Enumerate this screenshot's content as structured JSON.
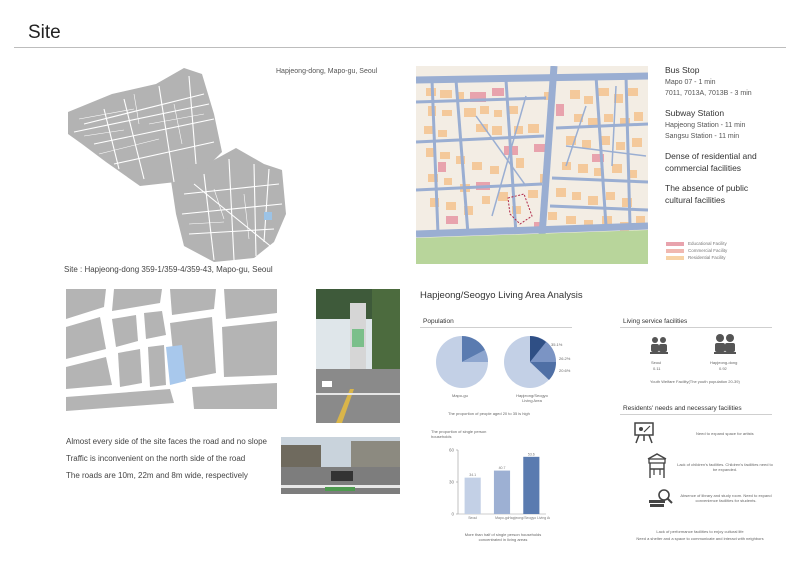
{
  "header": {
    "title": "Site"
  },
  "area_map": {
    "location_label": "Hapjeong-dong, Mapo-gu, Seoul",
    "site_caption": "Site : Hapjeong-dong 359-1/359-4/359-43, Mapo-gu, Seoul"
  },
  "transport": {
    "bus_heading": "Bus Stop",
    "bus_lines": [
      "Mapo 07 - 1 min",
      "7011, 7013A, 7013B - 3 min"
    ],
    "subway_heading": "Subway Station",
    "subway_lines": [
      "Hapjeong Station - 11 min",
      "Sangsu Station - 11 min"
    ],
    "note1": "Dense of residential and commercial facilities",
    "note2": "The absence of public cultural facilities"
  },
  "land_use_legend": [
    {
      "label": "Educational Facility",
      "color": "#e8a3ad"
    },
    {
      "label": "Commercial Facility",
      "color": "#f0b8b0"
    },
    {
      "label": "Residential Facility",
      "color": "#f7d3a6"
    }
  ],
  "road_notes": [
    "Almost every side of the site faces the road and no slope",
    "Traffic is inconvenient on the north side of the road",
    "The roads are 10m, 22m and 8m wide, respectively"
  ],
  "analysis": {
    "title": "Hapjeong/Seogyo Living Area Analysis",
    "population_heading": "Population",
    "pie_labels": [
      "Mapo-gu",
      "Hapjeong/Seogyo Living Area"
    ],
    "pie_values": [
      "35.1%",
      "26.2%",
      "20.6%"
    ],
    "population_caption": "The proportion of people aged 20 to 35 is high",
    "single_household_title": "The proportion of single person households",
    "single_household_caption": "More than half of single person households concentrated in living areas",
    "living_heading": "Living service facilities",
    "living_items": [
      {
        "name": "Seoul",
        "value": "0.11"
      },
      {
        "name": "Hapjeong-dong",
        "value": "0.92"
      }
    ],
    "living_caption": "Youth Welfare Facility(The youth population 20-39)",
    "needs_heading": "Residents' needs and necessary facilities",
    "needs": [
      {
        "icon": "artist-easel-icon",
        "text": "Need to expand space for artists"
      },
      {
        "icon": "playground-icon",
        "text": "Lack of children's facilities. Children's facilities need to be expanded."
      },
      {
        "icon": "library-icon",
        "text": "Absence of library and study room. Need to expand convenience facilities for students."
      }
    ],
    "needs_footer": [
      "Lack of performance facilities to enjoy cultural life",
      "Need a shelter and a space to communicate and interact with neighbors"
    ]
  },
  "chart_data": [
    {
      "type": "pie",
      "title": "",
      "labels": [
        "Mapo-gu",
        "Hapjeong/Seogyo Living Area"
      ],
      "value_labels": [
        "35.1%",
        "26.2%",
        "20.6%"
      ]
    },
    {
      "type": "bar",
      "title": "The proportion of single person households",
      "categories": [
        "Seoul",
        "Mapo-gu",
        "Hapjeong/Seogyo Living Area"
      ],
      "values": [
        34.1,
        40.7,
        53.6
      ],
      "value_labels": [
        "34.1",
        "40.7",
        "53.6"
      ],
      "ylim": [
        0,
        60
      ],
      "yticks": [
        0,
        30,
        60
      ],
      "colors": [
        "#c3d0e6",
        "#9db0d3",
        "#5a7bb0"
      ]
    }
  ]
}
